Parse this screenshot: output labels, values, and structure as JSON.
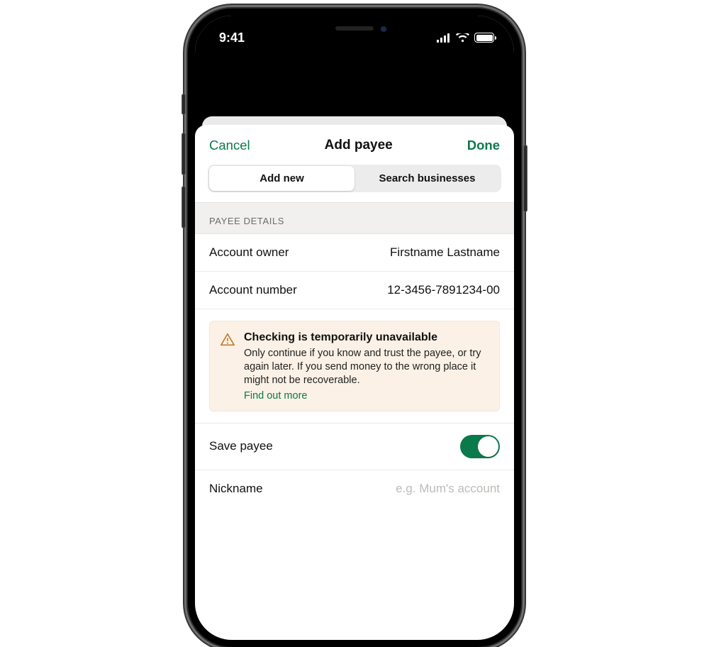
{
  "status": {
    "time": "9:41"
  },
  "header": {
    "cancel": "Cancel",
    "title": "Add payee",
    "done": "Done"
  },
  "segmented": {
    "add_new": "Add new",
    "search_businesses": "Search businesses"
  },
  "section": {
    "payee_details": "PAYEE DETAILS"
  },
  "fields": {
    "account_owner_label": "Account owner",
    "account_owner_value": "Firstname Lastname",
    "account_number_label": "Account number",
    "account_number_value": "12-3456-7891234-00",
    "save_payee_label": "Save payee",
    "nickname_label": "Nickname",
    "nickname_placeholder": "e.g. Mum's account"
  },
  "alert": {
    "title": "Checking is temporarily unavailable",
    "body": "Only continue if you know and trust the payee, or try again later. If you send money to the wrong place it might not be recoverable.",
    "link": "Find out more"
  }
}
